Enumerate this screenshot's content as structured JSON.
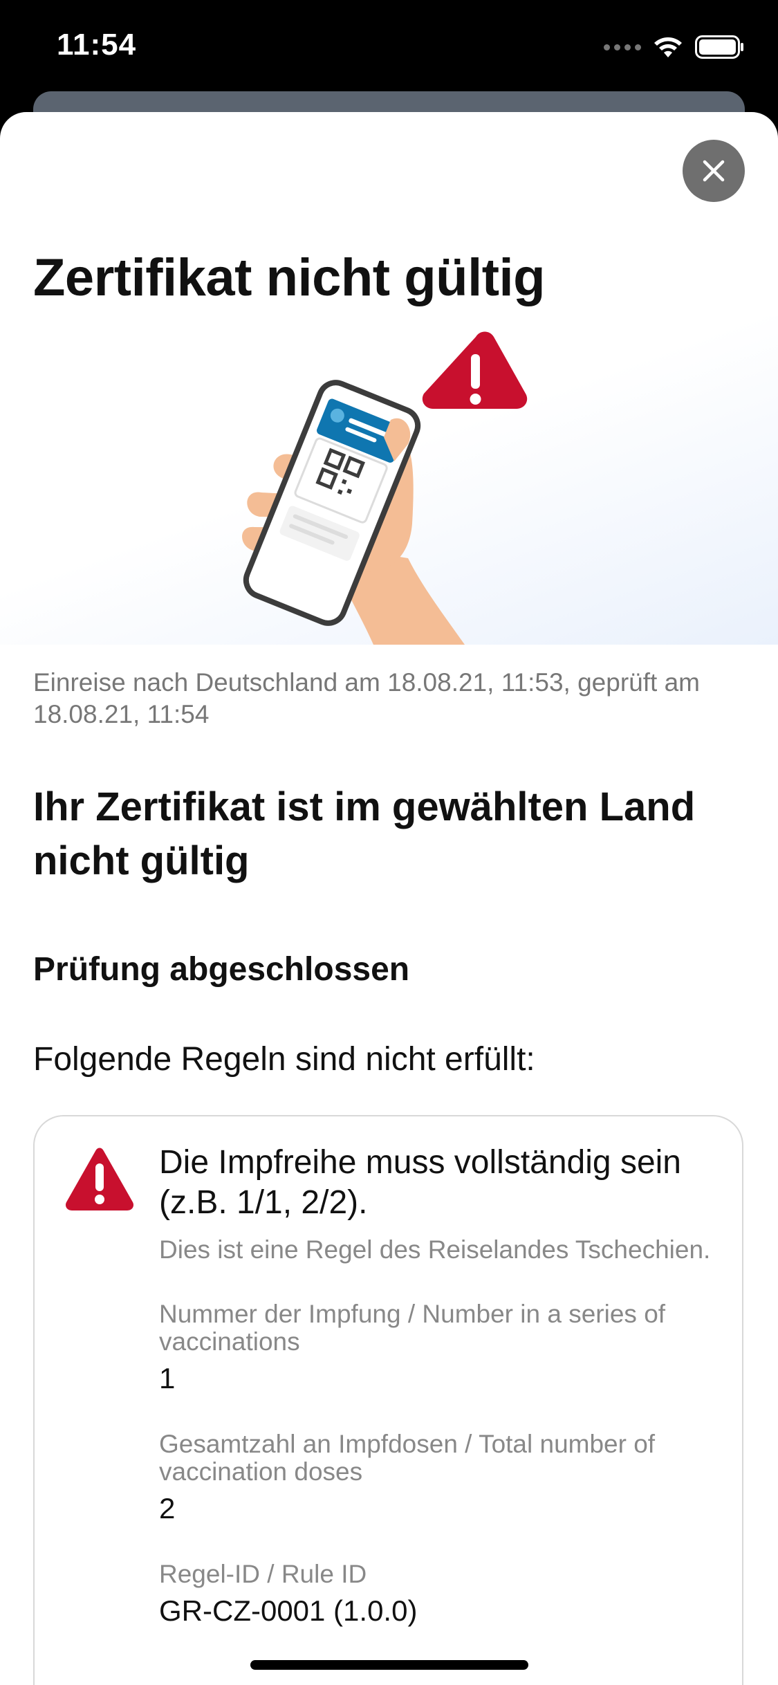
{
  "status_bar": {
    "time": "11:54"
  },
  "modal": {
    "close_icon": "close-icon",
    "title": "Zertifikat nicht gültig",
    "illustration": "hand-holding-phone-with-qr-code-and-warning-triangle",
    "check_meta": "Einreise nach Deutschland am 18.08.21, 11:53, geprüft am 18.08.21, 11:54",
    "result_heading": "Ihr Zertifikat ist im gewählten Land nicht gültig",
    "status_heading": "Prüfung abgeschlossen",
    "rules_intro": "Folgende Regeln sind nicht erfüllt:"
  },
  "rule": {
    "icon": "warning-triangle-icon",
    "title": "Die Impfreihe muss vollständig sein (z.B. 1/1, 2/2).",
    "source": "Dies ist eine Regel des Reiselandes Tschechien.",
    "fields": [
      {
        "label": "Nummer der Impfung / Number in a series of vaccinations",
        "value": "1"
      },
      {
        "label": "Gesamtzahl an Impfdosen / Total number of vaccination doses",
        "value": "2"
      },
      {
        "label": "Regel-ID / Rule ID",
        "value": "GR-CZ-0001 (1.0.0)"
      }
    ]
  },
  "colors": {
    "warning_red": "#c8102e",
    "accent_blue": "#0f76b0",
    "close_button_bg": "#6f6f6f"
  }
}
